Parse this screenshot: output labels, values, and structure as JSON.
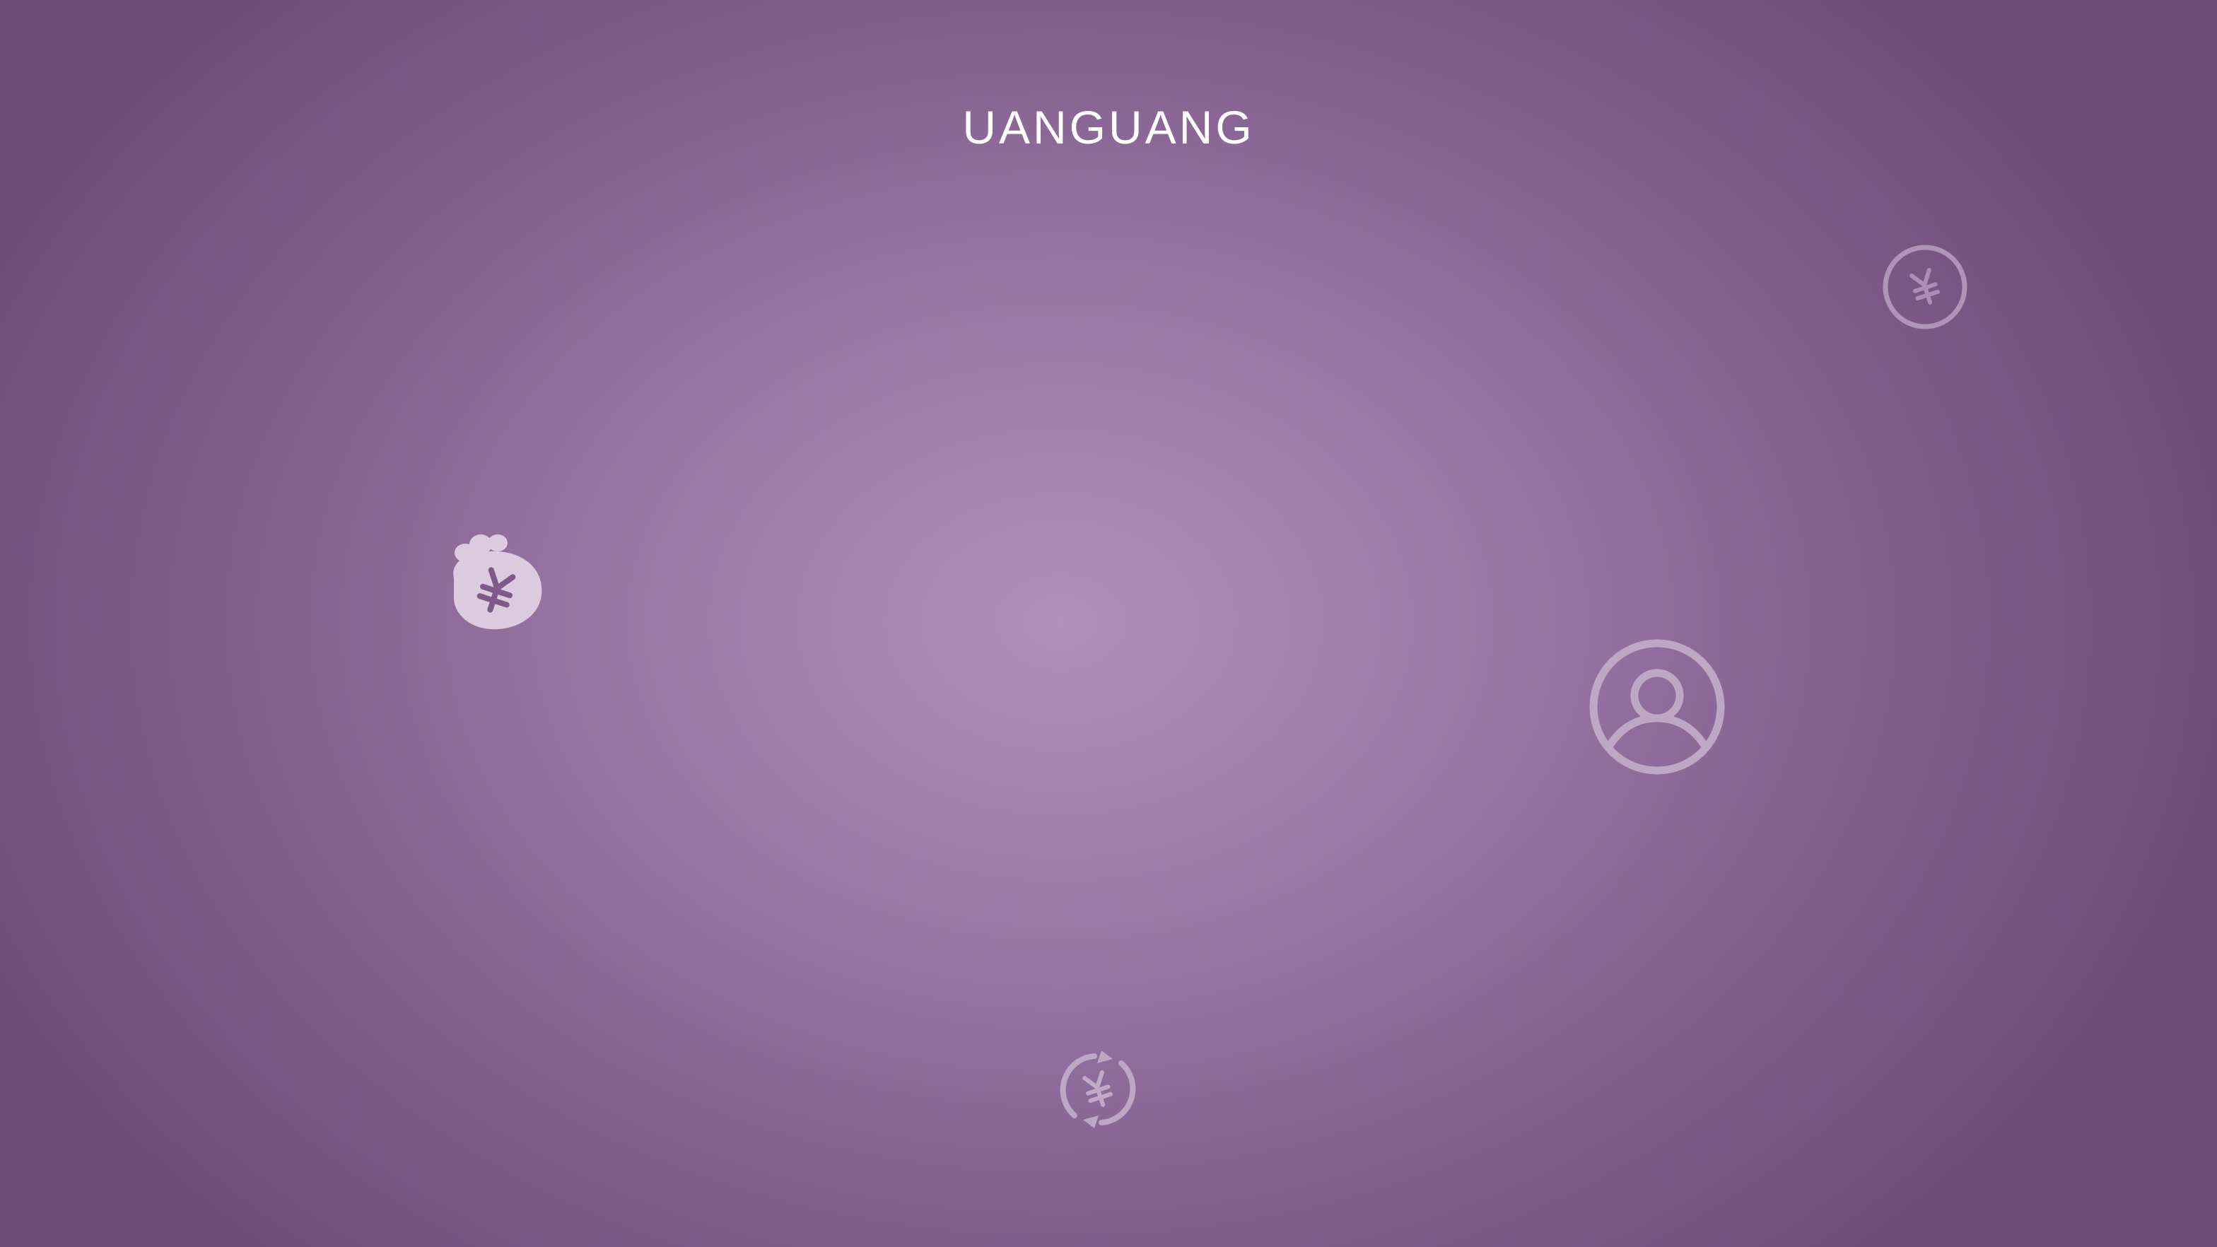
{
  "app": {
    "title": "UANGUANG"
  },
  "icons": [
    {
      "name": "yen-coin-icon"
    },
    {
      "name": "yen-money-bag-icon"
    },
    {
      "name": "user-account-icon"
    },
    {
      "name": "yen-exchange-icon"
    }
  ],
  "colors": {
    "background_center": "#b38fbb",
    "background_edge": "#6d4b79",
    "title_text": "#ffffff",
    "icon_light": "#d9c6dd",
    "icon_dark": "#7d5a88"
  }
}
